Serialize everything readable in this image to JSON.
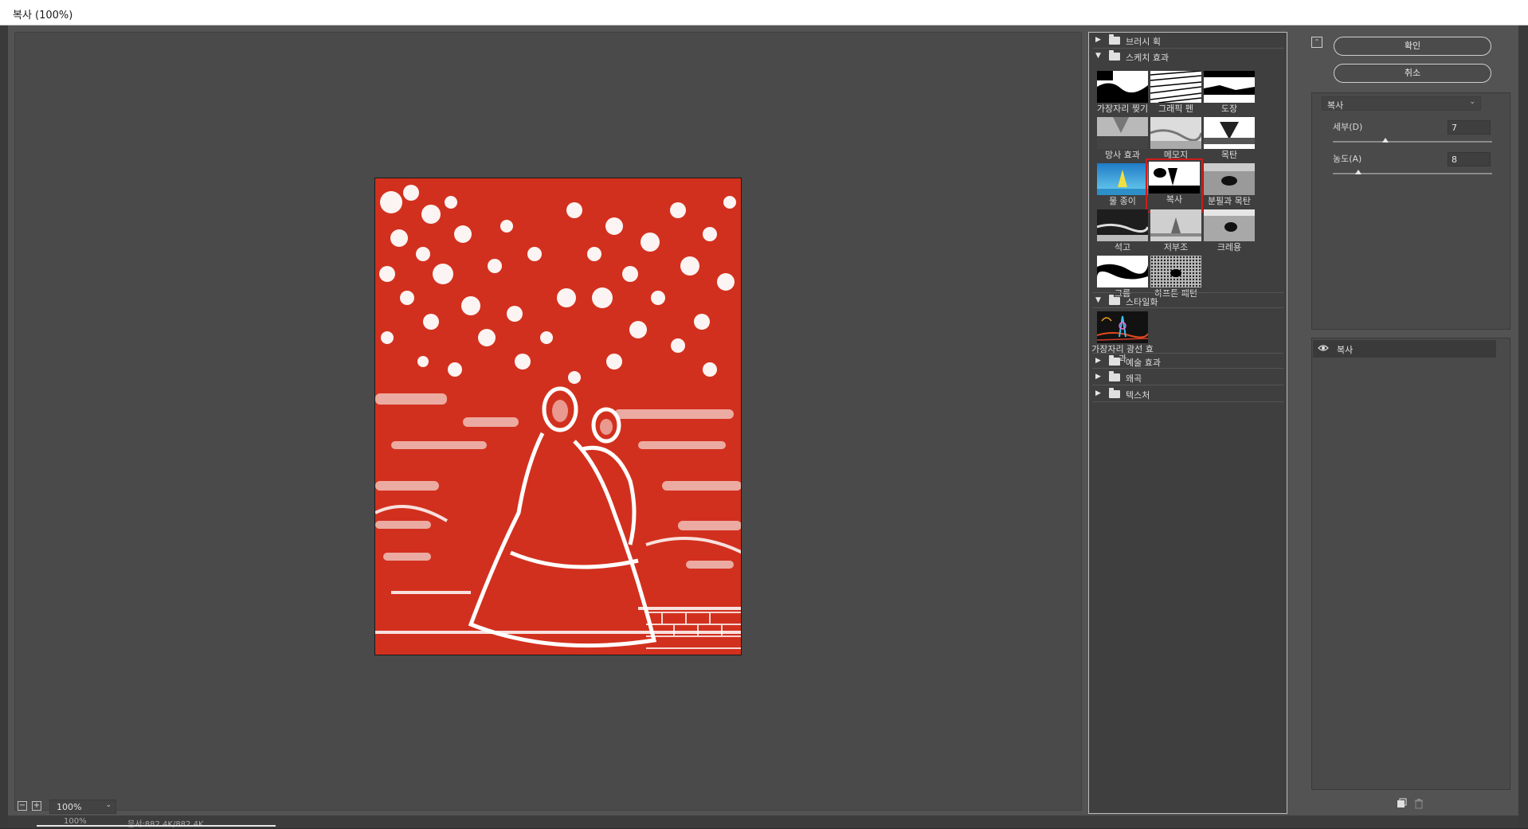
{
  "window": {
    "title": "복사 (100%)"
  },
  "preview": {
    "zoom": "100%"
  },
  "status": {
    "zoom": "100%",
    "doc": "문서:882.4K/882.4K"
  },
  "gallery": {
    "folders": [
      {
        "label": "브러시 획",
        "expanded": false
      },
      {
        "label": "스케치 효과",
        "expanded": true
      },
      {
        "label": "스타일화",
        "expanded": true
      },
      {
        "label": "예술 효과",
        "expanded": false
      },
      {
        "label": "왜곡",
        "expanded": false
      },
      {
        "label": "텍스처",
        "expanded": false
      }
    ],
    "sketch_filters": [
      {
        "label": "가장자리 찢기"
      },
      {
        "label": "그래픽 펜"
      },
      {
        "label": "도장"
      },
      {
        "label": "망사 효과"
      },
      {
        "label": "메모지"
      },
      {
        "label": "목탄"
      },
      {
        "label": "물 종이"
      },
      {
        "label": "복사",
        "selected": true
      },
      {
        "label": "분필과 목탄"
      },
      {
        "label": "석고"
      },
      {
        "label": "저부조"
      },
      {
        "label": "크레용"
      },
      {
        "label": "크롬"
      },
      {
        "label": "하프톤 패턴"
      }
    ],
    "stylize_filters": [
      {
        "label": "가장자리 광선 효과"
      }
    ]
  },
  "buttons": {
    "ok": "확인",
    "cancel": "취소"
  },
  "settings": {
    "filter": "복사",
    "params": [
      {
        "label": "세부(D)",
        "value": "7",
        "fraction": 0.33
      },
      {
        "label": "농도(A)",
        "value": "8",
        "fraction": 0.16
      }
    ]
  },
  "layers": [
    {
      "label": "복사",
      "visible": true
    }
  ],
  "colors": {
    "preview_red": "#d2301e",
    "selection": "#d11b1b",
    "panel": "#4a4a4a"
  }
}
